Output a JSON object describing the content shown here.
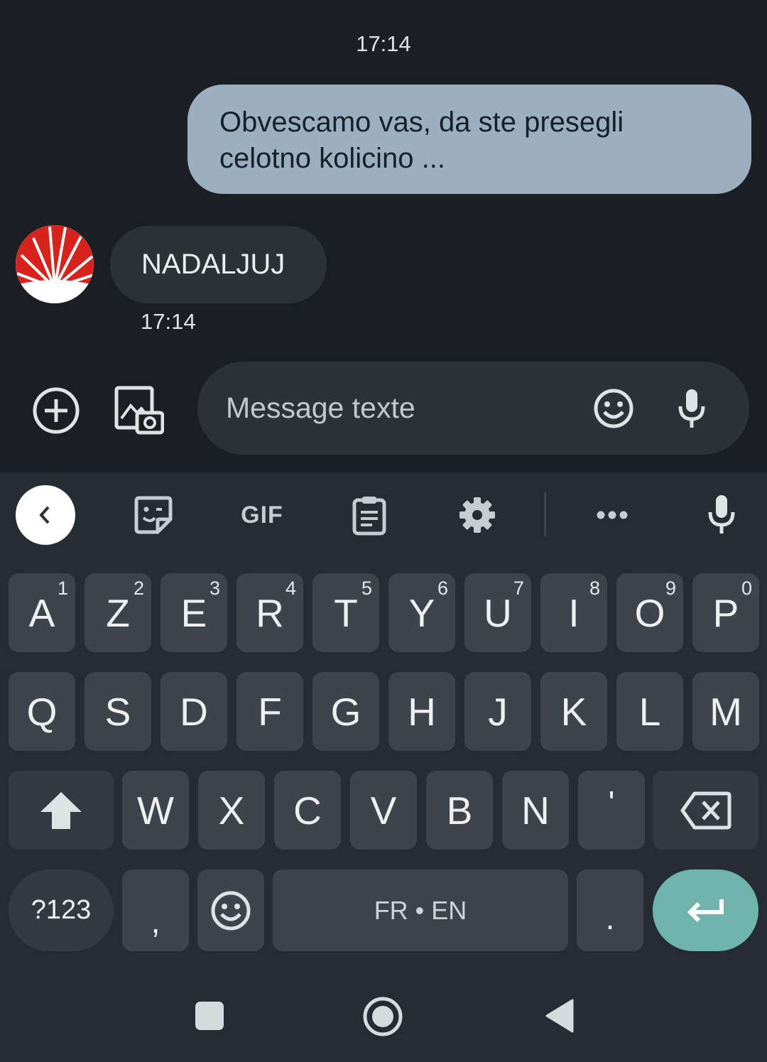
{
  "chat": {
    "timestamp_top": "17:14",
    "outgoing_message": "Obvescamo vas, da ste presegli celotno kolicino ...",
    "incoming_message": "NADALJUJ",
    "timestamp_incoming": "17:14"
  },
  "compose": {
    "placeholder": "Message texte",
    "icons": [
      "add-icon",
      "gallery-camera-icon",
      "emoji-icon",
      "microphone-icon"
    ]
  },
  "keyboard": {
    "toolbar": {
      "gif_label": "GIF",
      "icons": [
        "back-chevron-icon",
        "sticker-icon",
        "gif-icon",
        "clipboard-icon",
        "gear-icon",
        "more-icon",
        "microphone-icon"
      ]
    },
    "row1": [
      {
        "key": "A",
        "hint": "1"
      },
      {
        "key": "Z",
        "hint": "2"
      },
      {
        "key": "E",
        "hint": "3"
      },
      {
        "key": "R",
        "hint": "4"
      },
      {
        "key": "T",
        "hint": "5"
      },
      {
        "key": "Y",
        "hint": "6"
      },
      {
        "key": "U",
        "hint": "7"
      },
      {
        "key": "I",
        "hint": "8"
      },
      {
        "key": "O",
        "hint": "9"
      },
      {
        "key": "P",
        "hint": "0"
      }
    ],
    "row2": [
      "Q",
      "S",
      "D",
      "F",
      "G",
      "H",
      "J",
      "K",
      "L",
      "M"
    ],
    "row3": [
      "W",
      "X",
      "C",
      "V",
      "B",
      "N",
      "'"
    ],
    "symbols_label": "?123",
    "comma_label": ",",
    "space_label": "FR • EN",
    "period_label": ".",
    "accent_color": "#6fb5ad"
  },
  "navbar": {
    "icons": [
      "recents-icon",
      "home-icon",
      "back-icon"
    ]
  }
}
